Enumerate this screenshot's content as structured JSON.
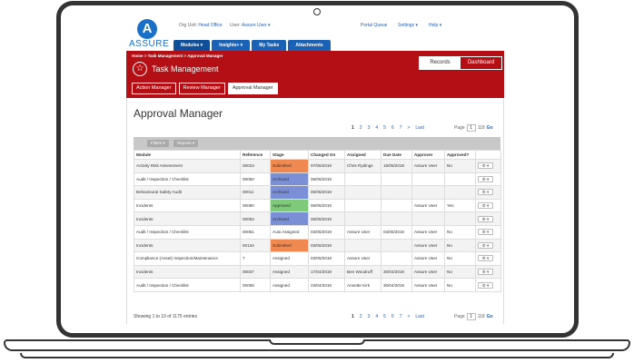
{
  "header": {
    "logo_letter": "A",
    "logo_text": "ASSURE",
    "org_label": "Org Unit:",
    "org_value": "Head Office",
    "user_label": "User:",
    "user_value": "Assure User",
    "portal_queue": "Portal Queue",
    "settings": "Settings",
    "help": "Help"
  },
  "nav": {
    "items": [
      {
        "label": "Modules ▾"
      },
      {
        "label": "Insights+ ▾"
      },
      {
        "label": "My Tasks"
      },
      {
        "label": "Attachments"
      }
    ]
  },
  "redband": {
    "breadcrumb": "Home > Task Management > Approval Manager",
    "icon": "star-icon",
    "title": "Task Management",
    "subtabs": [
      "Action Manager",
      "Review Manager",
      "Approval Manager"
    ],
    "toggle_records": "Records",
    "toggle_dashboard": "Dashboard",
    "color": "#b30f14"
  },
  "main": {
    "page_title": "Approval Manager",
    "pager": [
      "1",
      "2",
      "3",
      "4",
      "5",
      "6",
      "7",
      ">",
      "Last"
    ],
    "page_label": "Page",
    "page_value": "1",
    "page_of": "118",
    "go": "Go",
    "filters_btn": "Filters ▾",
    "reports_btn": "Reports ▾",
    "footer": "Showing 1 to 10 of 1175 entries"
  },
  "table": {
    "columns": [
      "Module",
      "Reference",
      "Stage",
      "Changed On",
      "Assigned",
      "Due Date",
      "Approver",
      "Approved?",
      ""
    ],
    "rows": [
      {
        "module": "Activity Risk Assessment",
        "ref": "00023",
        "stage": "Submitted",
        "stage_color": "#f0894f",
        "changed": "07/05/2019",
        "assigned": "Chris Rydings",
        "due": "15/05/2019",
        "approver": "Assure User",
        "approved": "No"
      },
      {
        "module": "Audit / Inspection / Checklist",
        "ref": "00050",
        "stage": "Archived",
        "stage_color": "#7a8fd6",
        "changed": "06/05/2019",
        "assigned": "",
        "due": "",
        "approver": "",
        "approved": ""
      },
      {
        "module": "Behavioural Safety Audit",
        "ref": "00011",
        "stage": "Archived",
        "stage_color": "#7a8fd6",
        "changed": "06/05/2019",
        "assigned": "",
        "due": "",
        "approver": "",
        "approved": ""
      },
      {
        "module": "Incidents",
        "ref": "00080",
        "stage": "Approved",
        "stage_color": "#7ec97a",
        "changed": "06/05/2019",
        "assigned": "",
        "due": "",
        "approver": "Assure User",
        "approved": "Yes"
      },
      {
        "module": "Incidents",
        "ref": "00083",
        "stage": "Archived",
        "stage_color": "#7a8fd6",
        "changed": "06/05/2019",
        "assigned": "",
        "due": "",
        "approver": "",
        "approved": ""
      },
      {
        "module": "Audit / Inspection / Checklist",
        "ref": "00051",
        "stage": "Auto Assigned",
        "stage_color": "",
        "changed": "03/05/2019",
        "assigned": "Assure User",
        "due": "04/05/2019",
        "approver": "Assure User",
        "approved": "No"
      },
      {
        "module": "Incidents",
        "ref": "00134",
        "stage": "Submitted",
        "stage_color": "#f0894f",
        "changed": "03/05/2019",
        "assigned": "",
        "due": "",
        "approver": "Assure User",
        "approved": "No"
      },
      {
        "module": "Compliance (Asset) Inspection/Maintenance",
        "ref": "7",
        "stage": "Assigned",
        "stage_color": "",
        "changed": "03/05/2019",
        "assigned": "Assure User",
        "due": "",
        "approver": "Assure User",
        "approved": "No"
      },
      {
        "module": "Incidents",
        "ref": "00037",
        "stage": "Assigned",
        "stage_color": "",
        "changed": "17/04/2019",
        "assigned": "Ben Woodruff",
        "due": "30/04/2019",
        "approver": "Assure User",
        "approved": "No"
      },
      {
        "module": "Audit / Inspection / Checklist",
        "ref": "00056",
        "stage": "Assigned",
        "stage_color": "",
        "changed": "23/04/2019",
        "assigned": "Annette Kirk",
        "due": "30/04/2019",
        "approver": "Assure User",
        "approved": "No"
      }
    ],
    "row_action": "⚙ ▾"
  }
}
